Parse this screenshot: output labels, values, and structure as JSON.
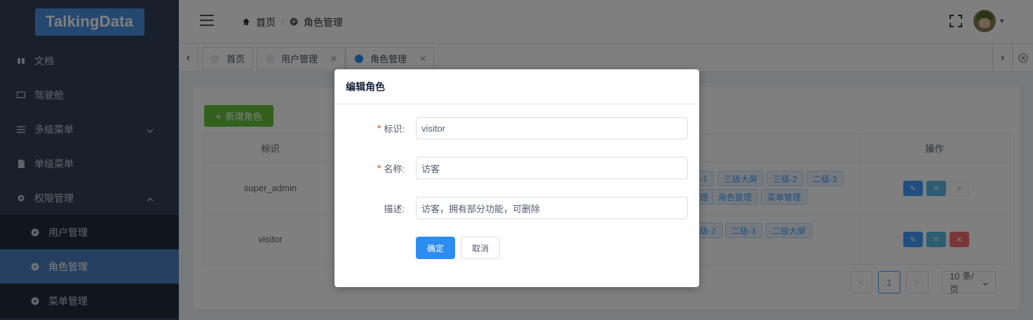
{
  "sidebar": {
    "logo_text": "TalkingData",
    "items": [
      {
        "label": "文档",
        "icon": "book-icon"
      },
      {
        "label": "驾驶舱",
        "icon": "monitor-icon"
      },
      {
        "label": "多级菜单",
        "icon": "list-icon"
      },
      {
        "label": "单级菜单",
        "icon": "file-icon"
      },
      {
        "label": "权限管理",
        "icon": "gear-icon"
      }
    ],
    "sub_items": [
      {
        "label": "用户管理",
        "icon": "compass-icon"
      },
      {
        "label": "角色管理",
        "icon": "compass-icon"
      },
      {
        "label": "菜单管理",
        "icon": "compass-icon"
      }
    ]
  },
  "header": {
    "breadcrumb": [
      "首页",
      "角色管理"
    ]
  },
  "tags": [
    {
      "label": "首页"
    },
    {
      "label": "用户管理"
    },
    {
      "label": "角色管理"
    }
  ],
  "main": {
    "add_button": "新增角色",
    "table": {
      "columns": [
        "标识",
        "操作"
      ],
      "rows": [
        {
          "id": "super_admin",
          "perms_line1": [
            "-1",
            "三级大屏",
            "三级-2",
            "二级-3"
          ],
          "perms_line2": [
            "理",
            "角色管理",
            "菜单管理"
          ]
        },
        {
          "id": "visitor",
          "perms_line1": [
            "级-2",
            "二级-3",
            "二级大屏"
          ]
        }
      ]
    },
    "pagination": {
      "prev": "<",
      "page": "1",
      "next": ">",
      "page_size": "10 条/页"
    }
  },
  "dialog": {
    "title": "编辑角色",
    "fields": [
      {
        "label": "标识:",
        "value": "visitor",
        "required": true
      },
      {
        "label": "名称:",
        "value": "访客",
        "required": true
      },
      {
        "label": "描述:",
        "value": "访客，拥有部分功能，可删除",
        "required": false
      }
    ],
    "ok_label": "确定",
    "cancel_label": "取消"
  }
}
